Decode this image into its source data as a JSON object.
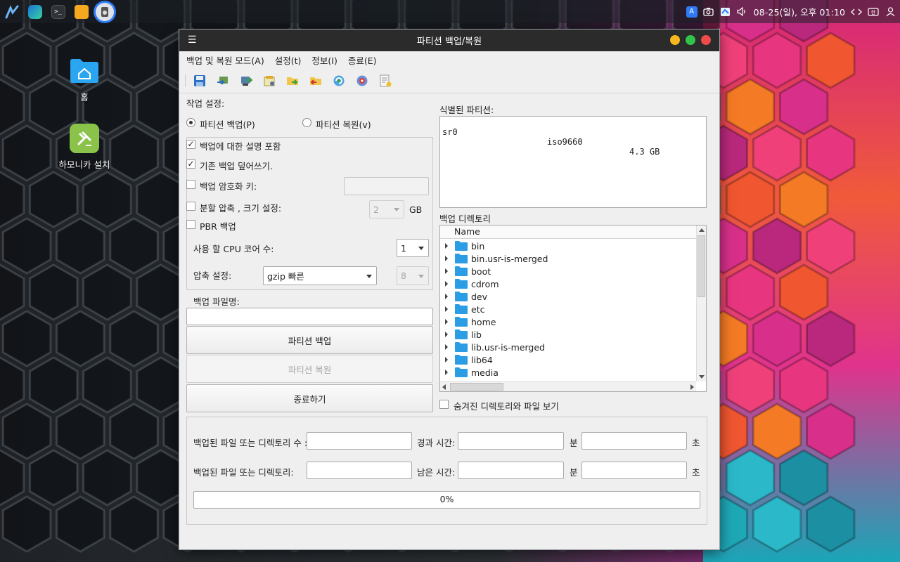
{
  "colors": {
    "window_bg": "#efefef",
    "titlebar": "#2b2b2b",
    "btn_minimize": "#f5b91f",
    "btn_maximize": "#35c24a",
    "btn_close": "#ee4b4b",
    "folder": "#2b9de4",
    "accent": "#2f7cf6"
  },
  "taskbar": {
    "apps": [
      {
        "icon": "hamonikr-logo-icon"
      },
      {
        "icon": "browser-icon"
      },
      {
        "icon": "terminal-icon",
        "glyph": ">_"
      },
      {
        "icon": "files-icon"
      },
      {
        "icon": "partition-backup-app-icon",
        "active": true
      }
    ],
    "tray": {
      "icons": [
        "language-indicator-icon",
        "screenshot-icon",
        "notes-icon",
        "volume-icon"
      ],
      "clock": "08-25(일), 오후 01:10",
      "extra_icons": [
        "network-icon",
        "keyboard-layout-icon",
        "user-icon"
      ]
    }
  },
  "desktop": {
    "icons": [
      {
        "label": "홈",
        "icon": "home-folder-icon"
      },
      {
        "label": "하모니카 설치",
        "icon": "installer-icon"
      }
    ]
  },
  "window": {
    "title": "파티션 백업/복원",
    "menu": [
      "백업 및 복원 모드(A)",
      "설정(t)",
      "정보(I)",
      "종료(E)"
    ],
    "toolbar": [
      "save-icon",
      "backup-mode-icon",
      "restore-mode-icon",
      "settings-icon",
      "open-folder-icon",
      "delete-folder-icon",
      "refresh-icon",
      "help-icon",
      "export-icon"
    ]
  },
  "settings": {
    "section_label": "작업 설정:",
    "radio_backup": "파티션 백업(P)",
    "radio_restore": "파티션 복원(v)",
    "selected_mode": "backup",
    "options": {
      "include_description": {
        "label": "백업에 대한 설명 포함",
        "checked": true
      },
      "overwrite": {
        "label": "기존 백업 덮어쓰기.",
        "checked": true
      },
      "encryption": {
        "label": "백업 암호화 키:",
        "checked": false,
        "value": ""
      },
      "split": {
        "label": "분할 압축 , 크기 설정:",
        "checked": false,
        "size": "2",
        "unit": "GB"
      },
      "pbr": {
        "label": "PBR 백업",
        "checked": false
      }
    },
    "cpu_cores_label": "사용 할 CPU 코어 수:",
    "cpu_cores_value": "1",
    "compression_label": "압축 설정:",
    "compression_value": "gzip 빠른",
    "compression_level": "8",
    "filename_label": "백업 파일명:",
    "filename_value": ""
  },
  "buttons": {
    "backup": "파티션 백업",
    "restore": "파티션 복원",
    "exit": "종료하기"
  },
  "partitions": {
    "label": "식별된 파티션:",
    "rows": [
      {
        "name": "sr0",
        "fs": "iso9660",
        "size": "4.3 GB"
      }
    ]
  },
  "backup_dir": {
    "label": "백업 디렉토리",
    "column": "Name",
    "items": [
      "bin",
      "bin.usr-is-merged",
      "boot",
      "cdrom",
      "dev",
      "etc",
      "home",
      "lib",
      "lib.usr-is-merged",
      "lib64",
      "media"
    ],
    "show_hidden_label": "숨겨진 디렉토리와 파일 보기",
    "show_hidden": false
  },
  "status": {
    "files_count_label": "백업된 파일 또는 디렉토리 수 :",
    "files_label": "백업된 파일 또는 디렉토리:",
    "elapsed_label": "경과 시간:",
    "remaining_label": "남은 시간:",
    "min_label": "분",
    "sec_label": "초",
    "progress": 0,
    "progress_text": "0%"
  }
}
